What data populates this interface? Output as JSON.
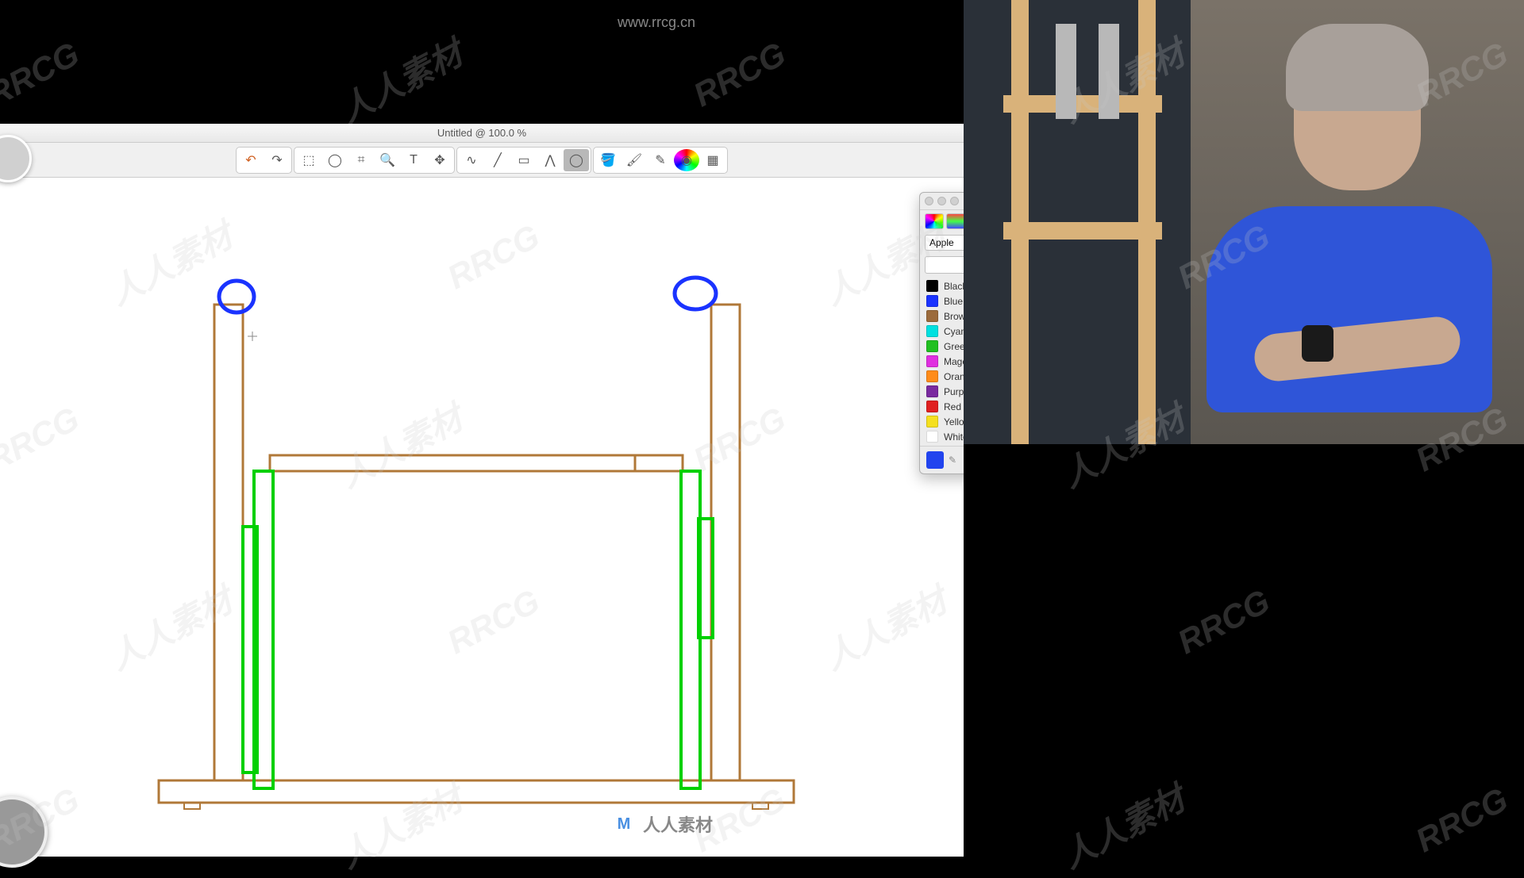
{
  "url_watermark": "www.rrcg.cn",
  "window": {
    "title": "Untitled @ 100.0 %"
  },
  "toolbar": {
    "undo": "↶",
    "redo": "↷",
    "rect_select": "⬚",
    "lasso": "◯",
    "crop": "⌗",
    "zoom": "🔍",
    "text": "T",
    "move": "✥",
    "freehand": "∿",
    "line": "╱",
    "rect": "▭",
    "polyline": "⋀",
    "ellipse": "◯",
    "fill": "🪣",
    "brush": "🖌",
    "pencil": "✎",
    "color": "◉",
    "swatches": "▦"
  },
  "colors": {
    "set": "Apple",
    "selected_hex": "#2244ee",
    "items": [
      {
        "hex": "#000000",
        "name": "Black"
      },
      {
        "hex": "#1a33ff",
        "name": "Blue"
      },
      {
        "hex": "#9c6b3c",
        "name": "Brown"
      },
      {
        "hex": "#00e0e0",
        "name": "Cyan"
      },
      {
        "hex": "#20c020",
        "name": "Green"
      },
      {
        "hex": "#e030e0",
        "name": "Magenta"
      },
      {
        "hex": "#ff8c1a",
        "name": "Orange"
      },
      {
        "hex": "#7a2aa0",
        "name": "Purple"
      },
      {
        "hex": "#e02020",
        "name": "Red"
      },
      {
        "hex": "#f5e020",
        "name": "Yellow"
      },
      {
        "hex": "#ffffff",
        "name": "White"
      }
    ]
  },
  "drawing": {
    "frame_color": "#b07838",
    "accent_color": "#00d000",
    "circle_color": "#1a33ff"
  },
  "watermark_text": "RRCG",
  "watermark_text_reverse": "人人素材",
  "bottom_logo": "人人素材"
}
